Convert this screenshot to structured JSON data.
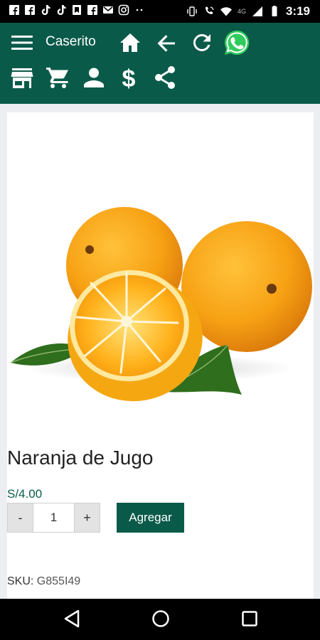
{
  "status_bar": {
    "time": "3:19",
    "network": "4G",
    "notification_icons": [
      "facebook-icon",
      "facebook-icon",
      "tiktok-icon",
      "tiktok-icon",
      "bookmark-icon",
      "facebook-icon",
      "gmail-icon",
      "instagram-icon",
      "more-dots-icon"
    ],
    "system_icons": [
      "vibrate-icon",
      "wifi-calling-icon",
      "wifi-icon",
      "signal-icon",
      "battery-icon"
    ]
  },
  "app_bar": {
    "title": "Caserito",
    "row1_icons": [
      "menu-icon",
      "home-icon",
      "back-arrow-icon",
      "refresh-icon",
      "whatsapp-icon"
    ],
    "row2_icons": [
      "store-icon",
      "cart-icon",
      "account-icon",
      "dollar-icon",
      "share-icon"
    ],
    "color": "#0a5a4a"
  },
  "product": {
    "name": "Naranja de Jugo",
    "price": "S/4.00",
    "quantity": "1",
    "minus_label": "-",
    "plus_label": "+",
    "add_label": "Agregar",
    "sku_label": "SKU:",
    "sku_value": "G855I49"
  },
  "nav_bar": {
    "icons": [
      "back-triangle-icon",
      "home-circle-icon",
      "recents-square-icon"
    ]
  }
}
